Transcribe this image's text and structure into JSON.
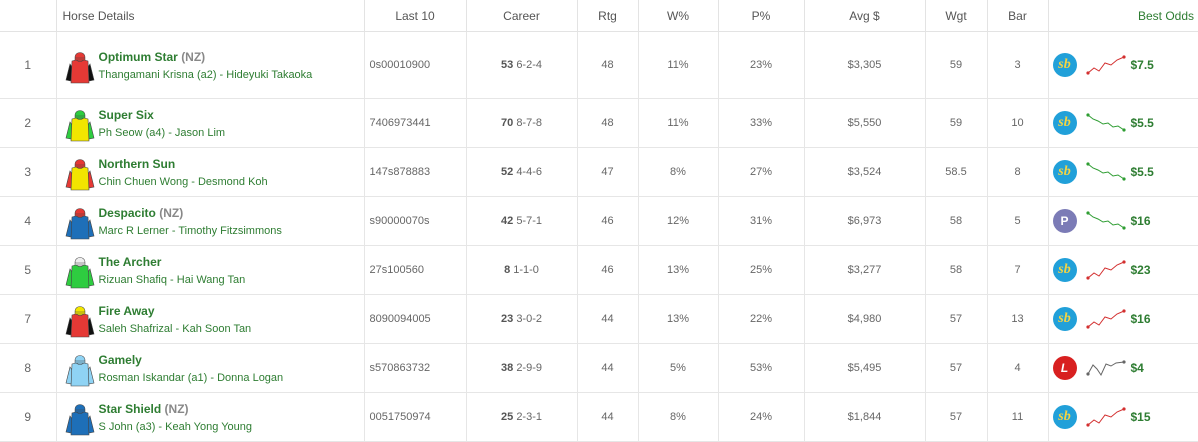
{
  "headers": {
    "num": "",
    "horse": "Horse Details",
    "last10": "Last 10",
    "career": "Career",
    "rtg": "Rtg",
    "wp": "W%",
    "pp": "P%",
    "avg": "Avg $",
    "wgt": "Wgt",
    "bar": "Bar",
    "best": "Best Odds"
  },
  "rows": [
    {
      "num": "1",
      "name": "Optimum Star",
      "country": "(NZ)",
      "jockey_trainer": "Thangamani Krisna (a2) - Hideyuki Takaoka",
      "last10": "0s00010900",
      "career_starts": "53",
      "career_rec": "6-2-4",
      "rtg": "48",
      "wp": "11%",
      "pp": "23%",
      "avg": "$3,305",
      "wgt": "59",
      "bar": "3",
      "bookie": "sb",
      "bookie_icon": "sportsbet-icon",
      "price": "$7.5",
      "trend": "up",
      "silk": {
        "body": "#e53935",
        "sleeve": "#111111",
        "cap": "#e53935"
      }
    },
    {
      "num": "2",
      "name": "Super Six",
      "country": "",
      "jockey_trainer": "Ph Seow (a4) - Jason Lim",
      "last10": "7406973441",
      "career_starts": "70",
      "career_rec": "8-7-8",
      "rtg": "48",
      "wp": "11%",
      "pp": "33%",
      "avg": "$5,550",
      "wgt": "59",
      "bar": "10",
      "bookie": "sb",
      "bookie_icon": "sportsbet-icon",
      "price": "$5.5",
      "trend": "down",
      "silk": {
        "body": "#f2e600",
        "sleeve": "#2ecc40",
        "cap": "#2ecc40"
      }
    },
    {
      "num": "3",
      "name": "Northern Sun",
      "country": "",
      "jockey_trainer": "Chin Chuen Wong - Desmond Koh",
      "last10": "147s878883",
      "career_starts": "52",
      "career_rec": "4-4-6",
      "rtg": "47",
      "wp": "8%",
      "pp": "27%",
      "avg": "$3,524",
      "wgt": "58.5",
      "bar": "8",
      "bookie": "sb",
      "bookie_icon": "sportsbet-icon",
      "price": "$5.5",
      "trend": "down",
      "silk": {
        "body": "#f2e600",
        "sleeve": "#e53935",
        "cap": "#e53935"
      }
    },
    {
      "num": "4",
      "name": "Despacito",
      "country": "(NZ)",
      "jockey_trainer": "Marc R Lerner - Timothy Fitzsimmons",
      "last10": "s90000070s",
      "career_starts": "42",
      "career_rec": "5-7-1",
      "rtg": "46",
      "wp": "12%",
      "pp": "31%",
      "avg": "$6,973",
      "wgt": "58",
      "bar": "5",
      "bookie": "P",
      "bookie_icon": "pointsbet-icon",
      "price": "$16",
      "trend": "down",
      "silk": {
        "body": "#1e6fb8",
        "sleeve": "#1e6fb8",
        "cap": "#e53935"
      }
    },
    {
      "num": "5",
      "name": "The Archer",
      "country": "",
      "jockey_trainer": "Rizuan Shafiq - Hai Wang Tan",
      "last10": "27s100560",
      "career_starts": "8",
      "career_rec": "1-1-0",
      "rtg": "46",
      "wp": "13%",
      "pp": "25%",
      "avg": "$3,277",
      "wgt": "58",
      "bar": "7",
      "bookie": "sb",
      "bookie_icon": "sportsbet-icon",
      "price": "$23",
      "trend": "up",
      "silk": {
        "body": "#2ecc40",
        "sleeve": "#2ecc40",
        "cap": "#eeeeee"
      }
    },
    {
      "num": "7",
      "name": "Fire Away",
      "country": "",
      "jockey_trainer": "Saleh Shafrizal - Kah Soon Tan",
      "last10": "8090094005",
      "career_starts": "23",
      "career_rec": "3-0-2",
      "rtg": "44",
      "wp": "13%",
      "pp": "22%",
      "avg": "$4,980",
      "wgt": "57",
      "bar": "13",
      "bookie": "sb",
      "bookie_icon": "sportsbet-icon",
      "price": "$16",
      "trend": "up",
      "silk": {
        "body": "#e53935",
        "sleeve": "#111111",
        "cap": "#f2e600"
      }
    },
    {
      "num": "8",
      "name": "Gamely",
      "country": "",
      "jockey_trainer": "Rosman Iskandar (a1) - Donna Logan",
      "last10": "s570863732",
      "career_starts": "38",
      "career_rec": "2-9-9",
      "rtg": "44",
      "wp": "5%",
      "pp": "53%",
      "avg": "$5,495",
      "wgt": "57",
      "bar": "4",
      "bookie": "L",
      "bookie_icon": "ladbrokes-icon",
      "price": "$4",
      "trend": "flat",
      "silk": {
        "body": "#8fd3f4",
        "sleeve": "#8fd3f4",
        "cap": "#8fd3f4"
      }
    },
    {
      "num": "9",
      "name": "Star Shield",
      "country": "(NZ)",
      "jockey_trainer": "S John (a3) - Keah Yong Young",
      "last10": "0051750974",
      "career_starts": "25",
      "career_rec": "2-3-1",
      "rtg": "44",
      "wp": "8%",
      "pp": "24%",
      "avg": "$1,844",
      "wgt": "57",
      "bar": "11",
      "bookie": "sb",
      "bookie_icon": "sportsbet-icon",
      "price": "$15",
      "trend": "up",
      "silk": {
        "body": "#1e6fb8",
        "sleeve": "#1e6fb8",
        "cap": "#1e6fb8"
      }
    }
  ]
}
